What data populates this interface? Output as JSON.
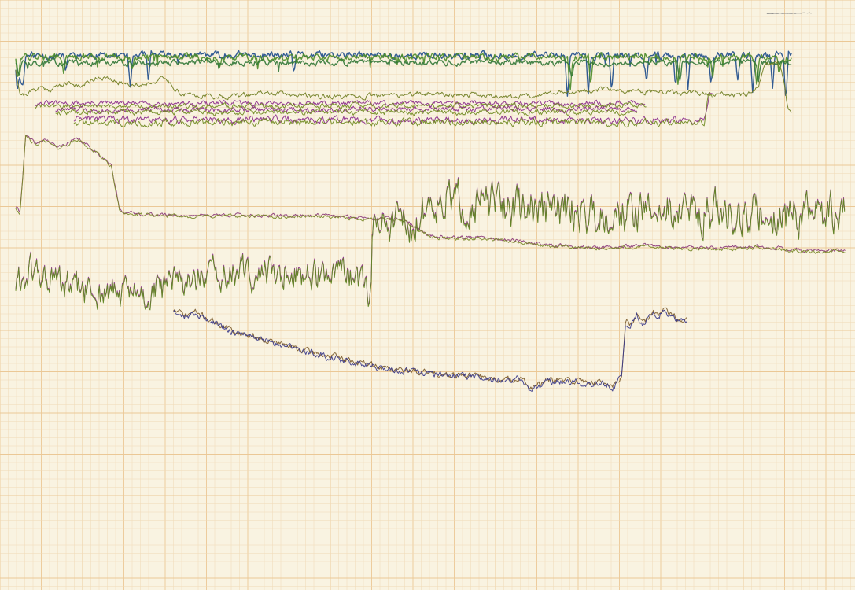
{
  "chart_data": {
    "type": "line",
    "title": "",
    "xlabel": "",
    "ylabel": "",
    "grid": true,
    "legend": "none",
    "x_range": [
      0,
      1000
    ],
    "y_range": [
      0,
      100
    ],
    "grid_color_minor": "#f0d9b5",
    "grid_color_major": "#ebc896",
    "series": [
      {
        "color": "#1f4e8c",
        "group": "top-band",
        "x_start": 0,
        "x_end": 935,
        "base": 90.6,
        "noise": 0.5,
        "dips": [
          [
            2,
            6.5
          ],
          [
            6,
            4.5
          ],
          [
            9,
            5.0
          ],
          [
            60,
            3.0
          ],
          [
            138,
            6.0
          ],
          [
            160,
            5.0
          ],
          [
            335,
            3.0
          ],
          [
            665,
            7.5
          ],
          [
            690,
            6.5
          ],
          [
            718,
            7.0
          ],
          [
            760,
            5.0
          ],
          [
            795,
            5.5
          ],
          [
            810,
            6.0
          ],
          [
            838,
            5.0
          ],
          [
            870,
            4.0
          ],
          [
            888,
            6.5
          ],
          [
            912,
            5.5
          ],
          [
            928,
            8.0
          ]
        ],
        "seed": 11
      },
      {
        "color": "#4c8c2a",
        "group": "top-band",
        "x_start": 0,
        "x_end": 935,
        "base": 90.3,
        "noise": 0.5,
        "dips": [
          [
            3,
            3.5
          ],
          [
            58,
            2.5
          ],
          [
            140,
            3.0
          ],
          [
            245,
            2.0
          ],
          [
            668,
            5.5
          ],
          [
            693,
            4.5
          ],
          [
            798,
            4.0
          ],
          [
            840,
            3.5
          ],
          [
            893,
            5.0
          ],
          [
            920,
            3.0
          ]
        ],
        "seed": 12
      },
      {
        "color": "#357a3a",
        "group": "top-band",
        "x_start": 0,
        "x_end": 935,
        "base": 89.4,
        "noise": 0.4,
        "dips": [
          [
            4,
            2.5
          ],
          [
            670,
            3.0
          ],
          [
            800,
            3.0
          ],
          [
            895,
            3.5
          ]
        ],
        "seed": 13
      },
      {
        "color": "#6f7d20",
        "group": "upper-trace",
        "x_start": 0,
        "x_end": 935,
        "points": [
          [
            0,
            88.3
          ],
          [
            5,
            84.3
          ],
          [
            10,
            83.9
          ],
          [
            20,
            84.6
          ],
          [
            30,
            85.3
          ],
          [
            40,
            84.8
          ],
          [
            60,
            85.9
          ],
          [
            80,
            85.5
          ],
          [
            100,
            87.1
          ],
          [
            120,
            86.1
          ],
          [
            150,
            85.6
          ],
          [
            180,
            86.7
          ],
          [
            200,
            84.0
          ],
          [
            250,
            83.6
          ],
          [
            300,
            84.2
          ],
          [
            400,
            83.5
          ],
          [
            500,
            84.2
          ],
          [
            600,
            83.6
          ],
          [
            660,
            84.4
          ],
          [
            700,
            84.8
          ],
          [
            760,
            84.5
          ],
          [
            800,
            84.2
          ],
          [
            850,
            84.1
          ],
          [
            880,
            83.8
          ],
          [
            895,
            84.9
          ],
          [
            902,
            89.0
          ],
          [
            918,
            89.6
          ],
          [
            925,
            87.0
          ],
          [
            930,
            82.0
          ],
          [
            935,
            80.5
          ]
        ],
        "noise": 0.35,
        "seed": 21
      },
      {
        "color": "#8a2a8a",
        "group": "mid-band",
        "x_start": 23,
        "x_end": 760,
        "points": [
          [
            23,
            82.5
          ],
          [
            760,
            82.5
          ]
        ],
        "noise": 0.35,
        "seed": 31
      },
      {
        "color": "#6f8a20",
        "group": "mid-band",
        "x_start": 23,
        "x_end": 760,
        "points": [
          [
            23,
            82.0
          ],
          [
            760,
            82.1
          ]
        ],
        "noise": 0.35,
        "seed": 32
      },
      {
        "color": "#8a2a8a",
        "group": "mid-band",
        "x_start": 48,
        "x_end": 750,
        "points": [
          [
            48,
            81.4
          ],
          [
            750,
            81.5
          ]
        ],
        "noise": 0.4,
        "seed": 33
      },
      {
        "color": "#6f8a20",
        "group": "mid-band",
        "x_start": 48,
        "x_end": 750,
        "points": [
          [
            48,
            81.0
          ],
          [
            750,
            81.0
          ]
        ],
        "noise": 0.4,
        "seed": 34
      },
      {
        "color": "#8a2a8a",
        "group": "mid-band",
        "x_start": 70,
        "x_end": 840,
        "points": [
          [
            70,
            79.7
          ],
          [
            830,
            79.7
          ],
          [
            835,
            84.0
          ],
          [
            840,
            84.2
          ]
        ],
        "noise": 0.5,
        "seed": 35
      },
      {
        "color": "#6f8a20",
        "group": "mid-band",
        "x_start": 70,
        "x_end": 840,
        "points": [
          [
            70,
            79.3
          ],
          [
            830,
            79.2
          ],
          [
            835,
            83.7
          ],
          [
            840,
            83.8
          ]
        ],
        "noise": 0.5,
        "seed": 36
      },
      {
        "color": "#8a3a7a",
        "group": "large-trace",
        "x_start": 0,
        "x_end": 1000,
        "points": [
          [
            0,
            65.0
          ],
          [
            5,
            64.0
          ],
          [
            12,
            77.0
          ],
          [
            25,
            75.5
          ],
          [
            35,
            76.5
          ],
          [
            50,
            75.0
          ],
          [
            75,
            76.5
          ],
          [
            100,
            74.0
          ],
          [
            115,
            72.0
          ],
          [
            125,
            64.5
          ],
          [
            140,
            63.8
          ],
          [
            200,
            63.5
          ],
          [
            260,
            63.6
          ],
          [
            320,
            63.4
          ],
          [
            360,
            63.6
          ],
          [
            400,
            63.2
          ],
          [
            450,
            63.0
          ],
          [
            470,
            62.6
          ],
          [
            500,
            60.0
          ],
          [
            520,
            59.8
          ],
          [
            550,
            59.8
          ],
          [
            580,
            59.5
          ],
          [
            600,
            59.2
          ],
          [
            640,
            58.5
          ],
          [
            700,
            58.0
          ],
          [
            760,
            58.4
          ],
          [
            800,
            58.0
          ],
          [
            860,
            58.0
          ],
          [
            900,
            58.2
          ],
          [
            960,
            57.5
          ],
          [
            995,
            57.6
          ]
        ],
        "noise": 0.25,
        "seed": 41
      },
      {
        "color": "#7a8a2a",
        "group": "large-trace",
        "x_start": 0,
        "x_end": 1000,
        "points": [
          [
            0,
            64.8
          ],
          [
            5,
            63.8
          ],
          [
            12,
            76.8
          ],
          [
            25,
            75.3
          ],
          [
            35,
            76.3
          ],
          [
            50,
            74.8
          ],
          [
            75,
            76.3
          ],
          [
            100,
            73.8
          ],
          [
            115,
            71.8
          ],
          [
            125,
            64.3
          ],
          [
            140,
            63.6
          ],
          [
            200,
            63.3
          ],
          [
            260,
            63.4
          ],
          [
            320,
            63.2
          ],
          [
            360,
            63.4
          ],
          [
            400,
            63.0
          ],
          [
            450,
            62.8
          ],
          [
            470,
            62.4
          ],
          [
            500,
            59.8
          ],
          [
            520,
            59.6
          ],
          [
            550,
            59.6
          ],
          [
            580,
            59.3
          ],
          [
            600,
            59.0
          ],
          [
            640,
            58.3
          ],
          [
            700,
            57.8
          ],
          [
            760,
            58.2
          ],
          [
            800,
            57.8
          ],
          [
            860,
            57.8
          ],
          [
            900,
            58.0
          ],
          [
            960,
            57.3
          ],
          [
            995,
            57.4
          ]
        ],
        "noise": 0.25,
        "seed": 42
      },
      {
        "color": "#8a2a8a",
        "group": "volatile-right",
        "x_start": 430,
        "x_end": 1000,
        "points": [
          [
            430,
            61.5
          ],
          [
            480,
            62.0
          ],
          [
            500,
            66.5
          ],
          [
            600,
            65.0
          ],
          [
            700,
            64.0
          ],
          [
            800,
            64.5
          ],
          [
            900,
            63.5
          ],
          [
            1000,
            64.0
          ]
        ],
        "noise": 2.8,
        "seed": 51
      },
      {
        "color": "#5f8a20",
        "group": "volatile-right",
        "x_start": 430,
        "x_end": 1000,
        "points": [
          [
            430,
            61.3
          ],
          [
            480,
            61.8
          ],
          [
            500,
            66.3
          ],
          [
            600,
            64.8
          ],
          [
            700,
            63.8
          ],
          [
            800,
            64.3
          ],
          [
            900,
            63.3
          ],
          [
            1000,
            63.8
          ]
        ],
        "noise": 2.8,
        "seed": 51
      },
      {
        "color": "#8a2a8a",
        "group": "volatile-left",
        "x_start": 0,
        "x_end": 430,
        "points": [
          [
            0,
            52.0
          ],
          [
            20,
            54.0
          ],
          [
            60,
            51.5
          ],
          [
            90,
            50.5
          ],
          [
            160,
            50.0
          ],
          [
            175,
            51.0
          ],
          [
            200,
            52.5
          ],
          [
            260,
            53.5
          ],
          [
            330,
            54.0
          ],
          [
            400,
            53.0
          ],
          [
            428,
            50.5
          ],
          [
            430,
            61.5
          ]
        ],
        "noise": 2.3,
        "seed": 61
      },
      {
        "color": "#5f8a20",
        "group": "volatile-left",
        "x_start": 0,
        "x_end": 430,
        "points": [
          [
            0,
            51.8
          ],
          [
            20,
            53.8
          ],
          [
            60,
            51.3
          ],
          [
            90,
            50.3
          ],
          [
            160,
            49.8
          ],
          [
            175,
            50.8
          ],
          [
            200,
            52.3
          ],
          [
            260,
            53.3
          ],
          [
            330,
            53.8
          ],
          [
            400,
            52.8
          ],
          [
            428,
            50.3
          ],
          [
            430,
            61.3
          ]
        ],
        "noise": 2.3,
        "seed": 61
      },
      {
        "color": "#7a5a2a",
        "group": "lower-trace",
        "x_start": 190,
        "x_end": 810,
        "points": [
          [
            190,
            47.5
          ],
          [
            205,
            46.5
          ],
          [
            215,
            47.2
          ],
          [
            260,
            44.0
          ],
          [
            300,
            42.5
          ],
          [
            350,
            40.5
          ],
          [
            400,
            39.0
          ],
          [
            450,
            37.5
          ],
          [
            500,
            36.8
          ],
          [
            540,
            36.5
          ],
          [
            590,
            35.5
          ],
          [
            610,
            36.0
          ],
          [
            620,
            34.0
          ],
          [
            640,
            35.5
          ],
          [
            680,
            35.5
          ],
          [
            715,
            35.0
          ],
          [
            720,
            34.5
          ],
          [
            730,
            36.5
          ],
          [
            735,
            45.5
          ],
          [
            740,
            44.5
          ],
          [
            748,
            47.0
          ],
          [
            755,
            45.0
          ],
          [
            762,
            46.0
          ],
          [
            768,
            47.0
          ],
          [
            775,
            46.5
          ],
          [
            780,
            47.5
          ],
          [
            790,
            46.5
          ],
          [
            800,
            46.0
          ],
          [
            810,
            45.5
          ]
        ],
        "noise": 0.45,
        "seed": 71
      },
      {
        "color": "#3a3a8a",
        "group": "lower-trace",
        "x_start": 190,
        "x_end": 810,
        "points": [
          [
            190,
            47.3
          ],
          [
            205,
            46.3
          ],
          [
            215,
            47.0
          ],
          [
            260,
            43.8
          ],
          [
            300,
            42.3
          ],
          [
            350,
            40.3
          ],
          [
            400,
            38.8
          ],
          [
            450,
            37.3
          ],
          [
            500,
            36.6
          ],
          [
            540,
            36.3
          ],
          [
            590,
            35.3
          ],
          [
            610,
            35.8
          ],
          [
            620,
            33.8
          ],
          [
            640,
            35.3
          ],
          [
            680,
            35.3
          ],
          [
            715,
            34.8
          ],
          [
            720,
            34.3
          ],
          [
            730,
            36.3
          ],
          [
            735,
            45.3
          ],
          [
            740,
            44.3
          ],
          [
            748,
            46.8
          ],
          [
            755,
            44.8
          ],
          [
            762,
            45.8
          ],
          [
            768,
            46.8
          ],
          [
            775,
            46.3
          ],
          [
            780,
            47.3
          ],
          [
            790,
            46.3
          ],
          [
            800,
            45.8
          ],
          [
            810,
            45.3
          ]
        ],
        "noise": 0.45,
        "seed": 72
      },
      {
        "color": "#8a8a8a",
        "group": "small-top-right",
        "x_start": 905,
        "x_end": 960,
        "points": [
          [
            905,
            97.7
          ],
          [
            960,
            97.8
          ]
        ],
        "noise": 0.05,
        "seed": 81
      }
    ]
  }
}
